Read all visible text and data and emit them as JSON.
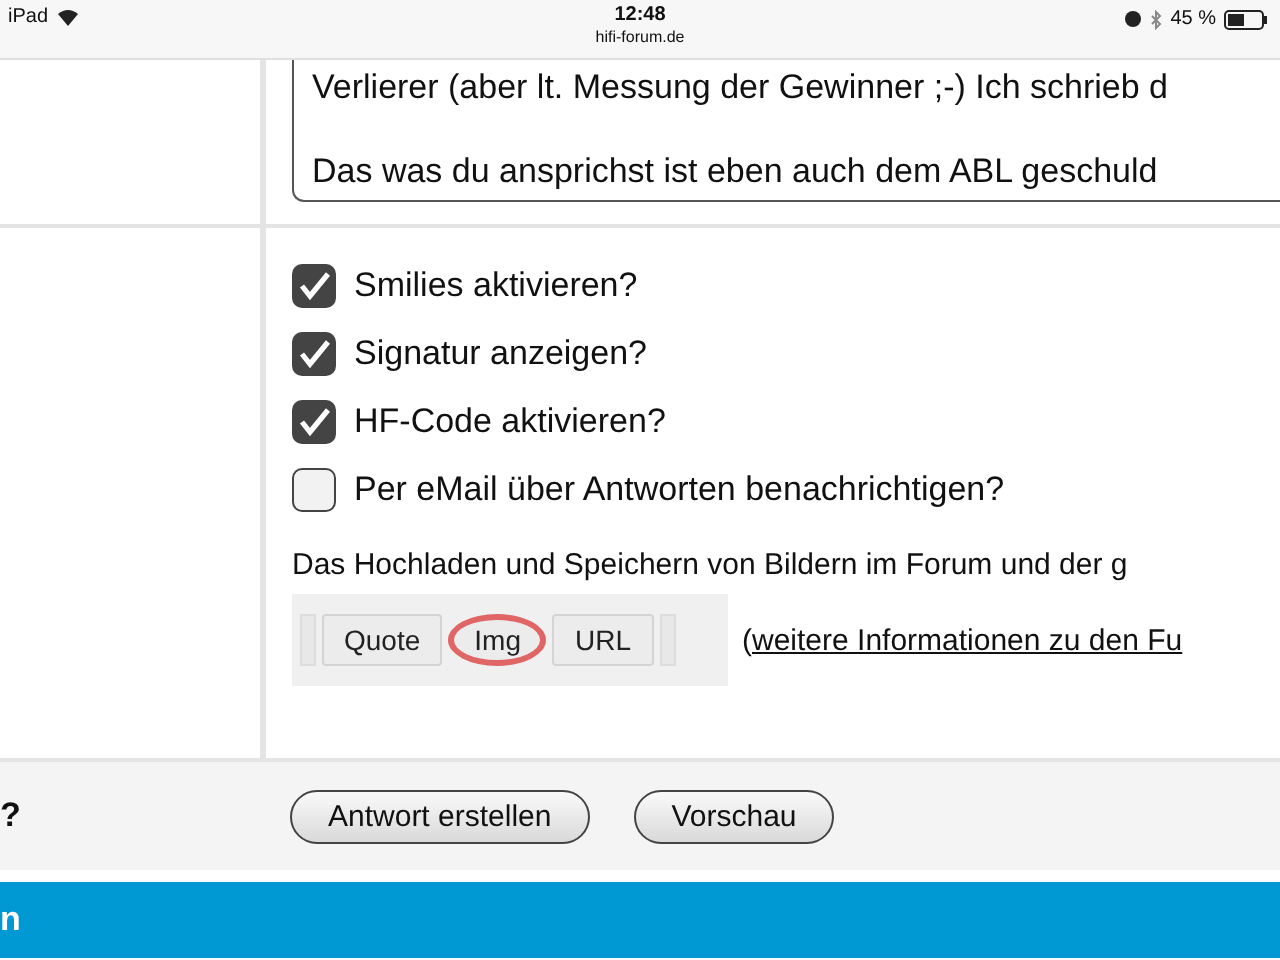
{
  "status_bar": {
    "device": "iPad",
    "time": "12:48",
    "url": "hifi-forum.de",
    "battery": "45 %"
  },
  "message": {
    "lines": [
      "Verlierer (aber lt. Messung der Gewinner ;-) Ich schrieb d",
      "Das was du ansprichst ist eben auch dem ABL geschuld"
    ]
  },
  "options": [
    {
      "label": "Smilies aktivieren?",
      "checked": true
    },
    {
      "label": "Signatur anzeigen?",
      "checked": true
    },
    {
      "label": "HF-Code aktivieren?",
      "checked": true
    },
    {
      "label": "Per eMail über Antworten benachrichtigen?",
      "checked": false
    }
  ],
  "upload_note": "Das Hochladen und Speichern von Bildern im Forum und der g",
  "code_buttons": [
    {
      "label": "Quote",
      "circled": false
    },
    {
      "label": "Img",
      "circled": true
    },
    {
      "label": "URL",
      "circled": false
    }
  ],
  "info_link": "weitere Informationen zu den Fu",
  "info_paren": "(",
  "footer_label": "?",
  "buttons": [
    "Antwort erstellen",
    "Vorschau"
  ],
  "section_title": "n"
}
